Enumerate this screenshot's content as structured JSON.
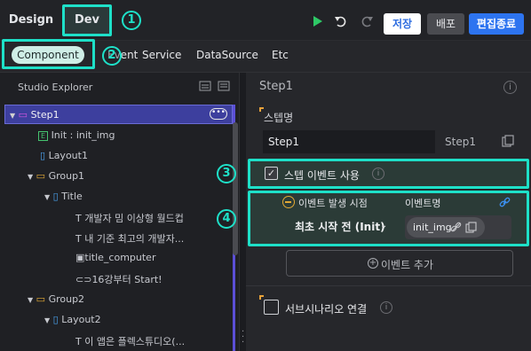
{
  "topbar": {
    "tab_design": "Design",
    "tab_dev": "Dev",
    "badge_1": "1",
    "save": "저장",
    "deploy": "배포",
    "exit_edit": "편집종료"
  },
  "subbar": {
    "tabs": [
      "Component",
      "Event",
      "Service",
      "DataSource",
      "Etc"
    ],
    "badge_2": "2"
  },
  "explorer": {
    "title": "Studio Explorer",
    "items": [
      {
        "label": "Step1"
      },
      {
        "label": "Init : init_img"
      },
      {
        "label": "Layout1"
      },
      {
        "label": "Group1"
      },
      {
        "label": "Title"
      },
      {
        "label": "T 개발자 밈 이상형 월드컵"
      },
      {
        "label": "T 내 기준 최고의 개발자..."
      },
      {
        "label": "title_computer"
      },
      {
        "label": "16강부터 Start!"
      },
      {
        "label": "Group2"
      },
      {
        "label": "Layout2"
      },
      {
        "label": "T 이 앱은 플렉스튜디오(..."
      }
    ]
  },
  "props": {
    "title": "Step1",
    "step_name_label": "스텝명",
    "step_name_value": "Step1",
    "step_id_value": "Step1",
    "badge_3": "3",
    "use_step_event": "스텝 이벤트 사용",
    "badge_4": "4",
    "event_timing_label": "이벤트 발생 시점",
    "event_name_label": "이벤트명",
    "event_timing_value": "최초 시작 전 (Init)",
    "event_name_value": "init_img",
    "add_event": "이벤트 추가",
    "sub_scenario": "서브시나리오 연결"
  }
}
